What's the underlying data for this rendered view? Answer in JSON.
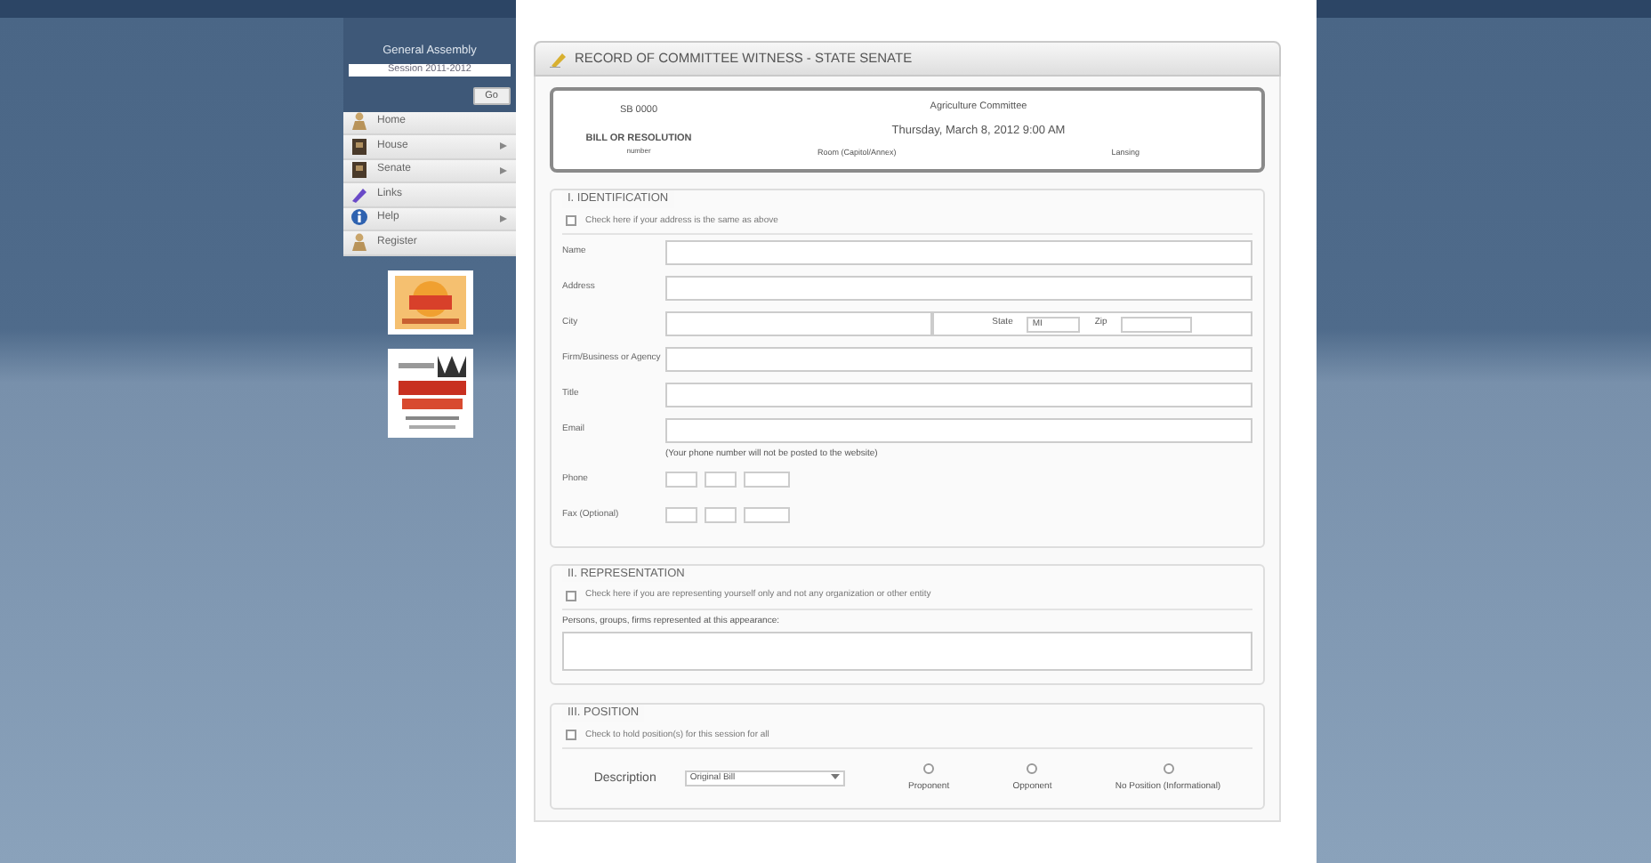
{
  "sidebar": {
    "title": "General Assembly",
    "session_field": {
      "value": "Session 2011-2012"
    },
    "go_button": "Go",
    "menu": [
      {
        "label": "Home",
        "has_submenu": false
      },
      {
        "label": "House",
        "has_submenu": true
      },
      {
        "label": "Senate",
        "has_submenu": true
      },
      {
        "label": "Links",
        "has_submenu": false
      },
      {
        "label": "Help",
        "has_submenu": true
      },
      {
        "label": "Register",
        "has_submenu": false
      }
    ]
  },
  "form": {
    "title": "RECORD OF COMMITTEE WITNESS - STATE SENATE",
    "info": {
      "bill": "SB 0000",
      "bill_label": "BILL OR RESOLUTION",
      "bill_note": "number",
      "committee": "Agriculture Committee",
      "date": "Thursday, March 8, 2012 9:00 AM",
      "room": "Room (Capitol/Annex)",
      "location": "Lansing"
    },
    "identification": {
      "heading": "I. IDENTIFICATION",
      "checkbox": {
        "label": "Check here if your address is the same as above",
        "checked": false
      },
      "fields": [
        {
          "kind": "text",
          "label": "Name"
        },
        {
          "kind": "text",
          "label": "Address"
        },
        {
          "kind": "city",
          "label": "City",
          "state_label": "State",
          "state_value": "MI",
          "zip_label": "Zip"
        },
        {
          "kind": "text",
          "label": "Firm/Business or Agency"
        },
        {
          "kind": "text",
          "label": "Title"
        },
        {
          "kind": "text",
          "label": "Email"
        },
        {
          "kind": "phone",
          "label": "Phone",
          "note": "(Your phone number will not be posted to the website)"
        },
        {
          "kind": "phone",
          "label": "Fax (Optional)"
        }
      ]
    },
    "representation": {
      "heading": "II. REPRESENTATION",
      "checkbox": {
        "label": "Check here if you are representing yourself only and not any organization or other entity",
        "checked": false
      },
      "represented_label": "Persons, groups, firms represented at this appearance:"
    },
    "position": {
      "heading": "III. POSITION",
      "checkbox": {
        "label": "Check to hold position(s) for this session for all",
        "checked": false
      },
      "description_label": "Description",
      "description_value": "Original Bill",
      "options": [
        {
          "label": "Proponent",
          "selected": false
        },
        {
          "label": "Opponent",
          "selected": false
        },
        {
          "label": "No Position (Informational)",
          "selected": false
        }
      ]
    }
  }
}
